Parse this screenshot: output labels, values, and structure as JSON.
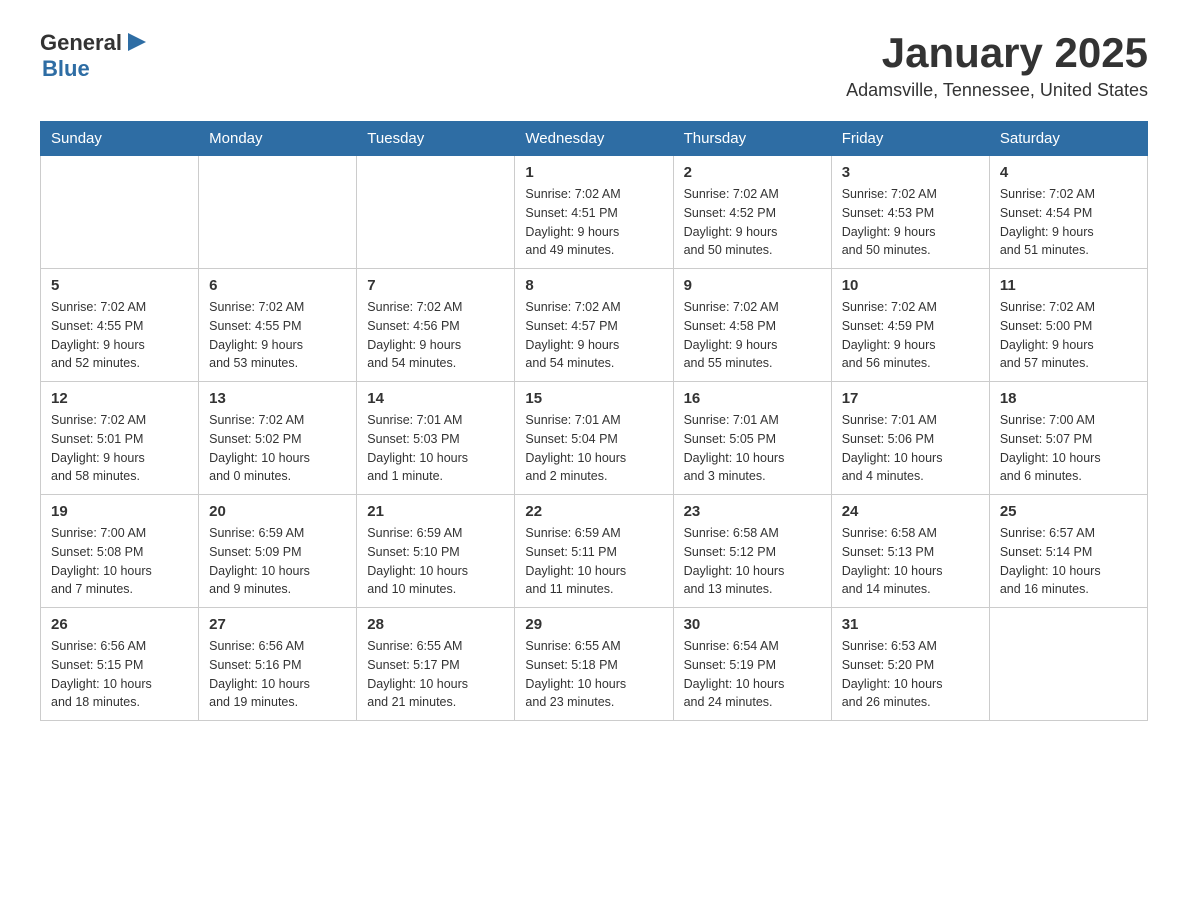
{
  "header": {
    "logo": {
      "general": "General",
      "blue": "Blue",
      "arrow_icon": "▶"
    },
    "title": "January 2025",
    "location": "Adamsville, Tennessee, United States"
  },
  "calendar": {
    "days_of_week": [
      "Sunday",
      "Monday",
      "Tuesday",
      "Wednesday",
      "Thursday",
      "Friday",
      "Saturday"
    ],
    "weeks": [
      [
        {
          "day": "",
          "info": ""
        },
        {
          "day": "",
          "info": ""
        },
        {
          "day": "",
          "info": ""
        },
        {
          "day": "1",
          "info": "Sunrise: 7:02 AM\nSunset: 4:51 PM\nDaylight: 9 hours\nand 49 minutes."
        },
        {
          "day": "2",
          "info": "Sunrise: 7:02 AM\nSunset: 4:52 PM\nDaylight: 9 hours\nand 50 minutes."
        },
        {
          "day": "3",
          "info": "Sunrise: 7:02 AM\nSunset: 4:53 PM\nDaylight: 9 hours\nand 50 minutes."
        },
        {
          "day": "4",
          "info": "Sunrise: 7:02 AM\nSunset: 4:54 PM\nDaylight: 9 hours\nand 51 minutes."
        }
      ],
      [
        {
          "day": "5",
          "info": "Sunrise: 7:02 AM\nSunset: 4:55 PM\nDaylight: 9 hours\nand 52 minutes."
        },
        {
          "day": "6",
          "info": "Sunrise: 7:02 AM\nSunset: 4:55 PM\nDaylight: 9 hours\nand 53 minutes."
        },
        {
          "day": "7",
          "info": "Sunrise: 7:02 AM\nSunset: 4:56 PM\nDaylight: 9 hours\nand 54 minutes."
        },
        {
          "day": "8",
          "info": "Sunrise: 7:02 AM\nSunset: 4:57 PM\nDaylight: 9 hours\nand 54 minutes."
        },
        {
          "day": "9",
          "info": "Sunrise: 7:02 AM\nSunset: 4:58 PM\nDaylight: 9 hours\nand 55 minutes."
        },
        {
          "day": "10",
          "info": "Sunrise: 7:02 AM\nSunset: 4:59 PM\nDaylight: 9 hours\nand 56 minutes."
        },
        {
          "day": "11",
          "info": "Sunrise: 7:02 AM\nSunset: 5:00 PM\nDaylight: 9 hours\nand 57 minutes."
        }
      ],
      [
        {
          "day": "12",
          "info": "Sunrise: 7:02 AM\nSunset: 5:01 PM\nDaylight: 9 hours\nand 58 minutes."
        },
        {
          "day": "13",
          "info": "Sunrise: 7:02 AM\nSunset: 5:02 PM\nDaylight: 10 hours\nand 0 minutes."
        },
        {
          "day": "14",
          "info": "Sunrise: 7:01 AM\nSunset: 5:03 PM\nDaylight: 10 hours\nand 1 minute."
        },
        {
          "day": "15",
          "info": "Sunrise: 7:01 AM\nSunset: 5:04 PM\nDaylight: 10 hours\nand 2 minutes."
        },
        {
          "day": "16",
          "info": "Sunrise: 7:01 AM\nSunset: 5:05 PM\nDaylight: 10 hours\nand 3 minutes."
        },
        {
          "day": "17",
          "info": "Sunrise: 7:01 AM\nSunset: 5:06 PM\nDaylight: 10 hours\nand 4 minutes."
        },
        {
          "day": "18",
          "info": "Sunrise: 7:00 AM\nSunset: 5:07 PM\nDaylight: 10 hours\nand 6 minutes."
        }
      ],
      [
        {
          "day": "19",
          "info": "Sunrise: 7:00 AM\nSunset: 5:08 PM\nDaylight: 10 hours\nand 7 minutes."
        },
        {
          "day": "20",
          "info": "Sunrise: 6:59 AM\nSunset: 5:09 PM\nDaylight: 10 hours\nand 9 minutes."
        },
        {
          "day": "21",
          "info": "Sunrise: 6:59 AM\nSunset: 5:10 PM\nDaylight: 10 hours\nand 10 minutes."
        },
        {
          "day": "22",
          "info": "Sunrise: 6:59 AM\nSunset: 5:11 PM\nDaylight: 10 hours\nand 11 minutes."
        },
        {
          "day": "23",
          "info": "Sunrise: 6:58 AM\nSunset: 5:12 PM\nDaylight: 10 hours\nand 13 minutes."
        },
        {
          "day": "24",
          "info": "Sunrise: 6:58 AM\nSunset: 5:13 PM\nDaylight: 10 hours\nand 14 minutes."
        },
        {
          "day": "25",
          "info": "Sunrise: 6:57 AM\nSunset: 5:14 PM\nDaylight: 10 hours\nand 16 minutes."
        }
      ],
      [
        {
          "day": "26",
          "info": "Sunrise: 6:56 AM\nSunset: 5:15 PM\nDaylight: 10 hours\nand 18 minutes."
        },
        {
          "day": "27",
          "info": "Sunrise: 6:56 AM\nSunset: 5:16 PM\nDaylight: 10 hours\nand 19 minutes."
        },
        {
          "day": "28",
          "info": "Sunrise: 6:55 AM\nSunset: 5:17 PM\nDaylight: 10 hours\nand 21 minutes."
        },
        {
          "day": "29",
          "info": "Sunrise: 6:55 AM\nSunset: 5:18 PM\nDaylight: 10 hours\nand 23 minutes."
        },
        {
          "day": "30",
          "info": "Sunrise: 6:54 AM\nSunset: 5:19 PM\nDaylight: 10 hours\nand 24 minutes."
        },
        {
          "day": "31",
          "info": "Sunrise: 6:53 AM\nSunset: 5:20 PM\nDaylight: 10 hours\nand 26 minutes."
        },
        {
          "day": "",
          "info": ""
        }
      ]
    ]
  }
}
